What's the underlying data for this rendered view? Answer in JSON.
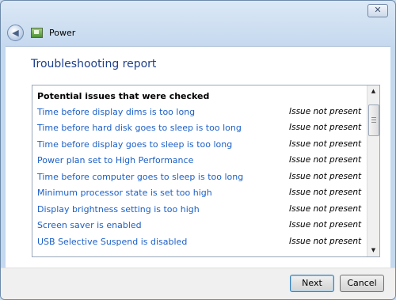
{
  "titlebar": {
    "close_glyph": "✕"
  },
  "nav": {
    "back_glyph": "◀",
    "app_title": "Power"
  },
  "main": {
    "heading": "Troubleshooting report"
  },
  "report": {
    "header": "Potential issues that were checked",
    "rows": [
      {
        "issue": "Time before display dims is too long",
        "status": "Issue not present"
      },
      {
        "issue": "Time before hard disk goes to sleep is too long",
        "status": "Issue not present"
      },
      {
        "issue": "Time before display goes to sleep is too long",
        "status": "Issue not present"
      },
      {
        "issue": "Power plan set to High Performance",
        "status": "Issue not present"
      },
      {
        "issue": "Time before computer goes to sleep is too long",
        "status": "Issue not present"
      },
      {
        "issue": "Minimum processor state is set too high",
        "status": "Issue not present"
      },
      {
        "issue": "Display brightness setting is too high",
        "status": "Issue not present"
      },
      {
        "issue": "Screen saver is enabled",
        "status": "Issue not present"
      },
      {
        "issue": "USB Selective Suspend is disabled",
        "status": "Issue not present"
      }
    ],
    "scroll_up_glyph": "▲",
    "scroll_down_glyph": "▼"
  },
  "footer": {
    "next_label": "Next",
    "cancel_label": "Cancel"
  },
  "colors": {
    "link": "#1b5fc7",
    "heading": "#1e3f8c"
  }
}
